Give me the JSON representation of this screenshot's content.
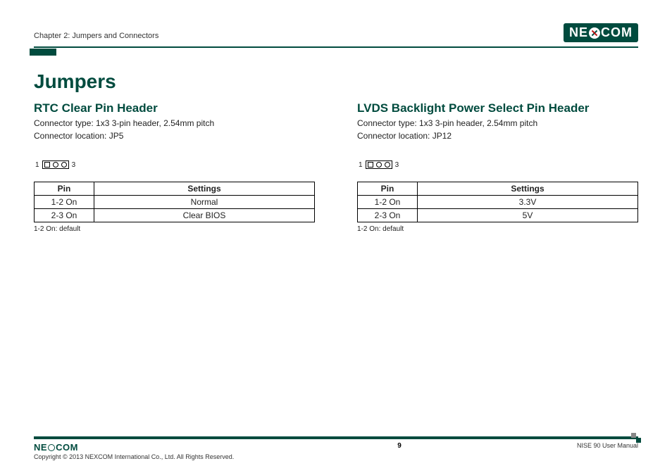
{
  "header": {
    "chapter": "Chapter 2: Jumpers and Connectors",
    "logo_text_left": "NE",
    "logo_text_right": "COM"
  },
  "page_title": "Jumpers",
  "left": {
    "title": "RTC Clear Pin Header",
    "connector_type": "Connector type: 1x3 3-pin header, 2.54mm pitch",
    "connector_location": "Connector location: JP5",
    "pin_start": "1",
    "pin_end": "3",
    "table": {
      "headers": {
        "pin": "Pin",
        "settings": "Settings"
      },
      "rows": [
        {
          "pin": "1-2 On",
          "settings": "Normal"
        },
        {
          "pin": "2-3 On",
          "settings": "Clear BIOS"
        }
      ]
    },
    "footnote": "1-2 On: default"
  },
  "right": {
    "title": "LVDS Backlight Power Select Pin Header",
    "connector_type": "Connector type: 1x3 3-pin header, 2.54mm pitch",
    "connector_location": "Connector location: JP12",
    "pin_start": "1",
    "pin_end": "3",
    "table": {
      "headers": {
        "pin": "Pin",
        "settings": "Settings"
      },
      "rows": [
        {
          "pin": "1-2 On",
          "settings": "3.3V"
        },
        {
          "pin": "2-3 On",
          "settings": "5V"
        }
      ]
    },
    "footnote": "1-2 On: default"
  },
  "footer": {
    "copyright": "Copyright © 2013 NEXCOM International Co., Ltd. All Rights Reserved.",
    "page_number": "9",
    "manual": "NISE 90 User Manual"
  }
}
